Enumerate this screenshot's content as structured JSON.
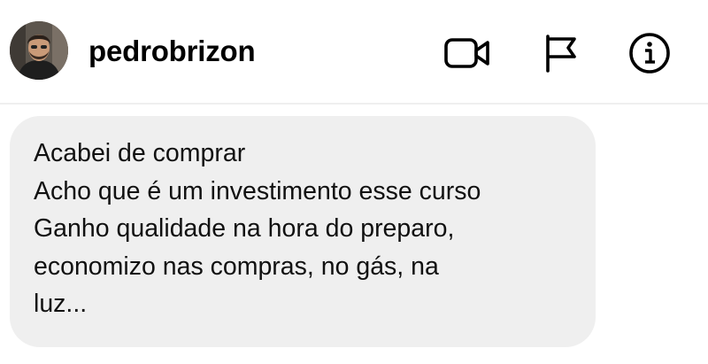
{
  "header": {
    "username": "pedrobrizon",
    "avatar": "profile-photo",
    "actions": [
      {
        "icon": "video-camera-icon"
      },
      {
        "icon": "flag-icon"
      },
      {
        "icon": "info-icon"
      }
    ]
  },
  "message": {
    "lines": [
      "Acabei de comprar",
      "Acho que é um investimento esse curso",
      "Ganho qualidade na hora do preparo,",
      "economizo nas compras, no gás, na",
      "luz..."
    ]
  },
  "colors": {
    "background": "#ffffff",
    "bubble": "#efefef",
    "text": "#000000",
    "divider": "#efefef"
  }
}
